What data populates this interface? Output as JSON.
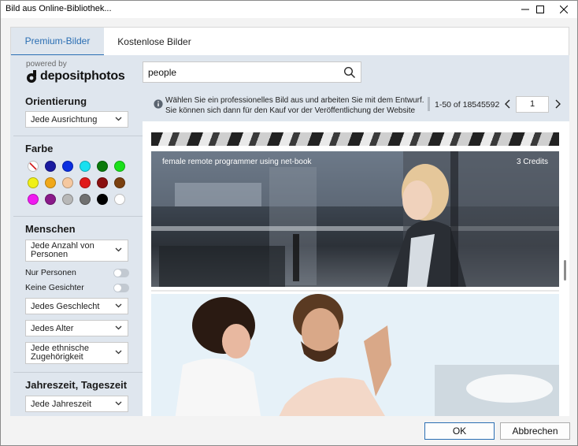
{
  "window": {
    "title": "Bild aus Online-Bibliothek..."
  },
  "tabs": [
    {
      "label": "Premium-Bilder",
      "active": true
    },
    {
      "label": "Kostenlose Bilder",
      "active": false
    }
  ],
  "brand": {
    "powered_by": "powered by",
    "name": "depositphotos"
  },
  "search": {
    "value": "people"
  },
  "filters": {
    "orientation": {
      "title": "Orientierung",
      "selected": "Jede Ausrichtung"
    },
    "color": {
      "title": "Farbe",
      "swatches": [
        "#1a1aa0",
        "#0a2ee0",
        "#18e0f0",
        "#0a7a0a",
        "#1ae01a",
        "#f0f018",
        "#f0a81a",
        "#f5c8a0",
        "#e01a1a",
        "#8a1010",
        "#7a4010",
        "#f01af0",
        "#8a1a8a",
        "#b8b8b8",
        "#707070",
        "#000000",
        "#ffffff"
      ]
    },
    "people": {
      "title": "Menschen",
      "count_lines": [
        "Jede Anzahl von",
        "Personen"
      ],
      "only_people": "Nur Personen",
      "no_faces": "Keine Gesichter",
      "gender": "Jedes Geschlecht",
      "age": "Jedes Alter",
      "ethnicity_lines": [
        "Jede ethnische",
        "Zugehörigkeit"
      ]
    },
    "season": {
      "title": "Jahreszeit, Tageszeit",
      "selected": "Jede Jahreszeit"
    }
  },
  "info": {
    "text": "Wählen Sie ein professionelles Bild aus und arbeiten Sie mit dem Entwurf. Sie können sich dann für den Kauf vor der Veröffentlichung der Website",
    "range": "1-50 of 18545592",
    "page": "1"
  },
  "results": [
    {
      "caption": "female remote programmer using net-book",
      "credits": "3 Credits"
    }
  ],
  "buttons": {
    "ok": "OK",
    "cancel": "Abbrechen"
  }
}
